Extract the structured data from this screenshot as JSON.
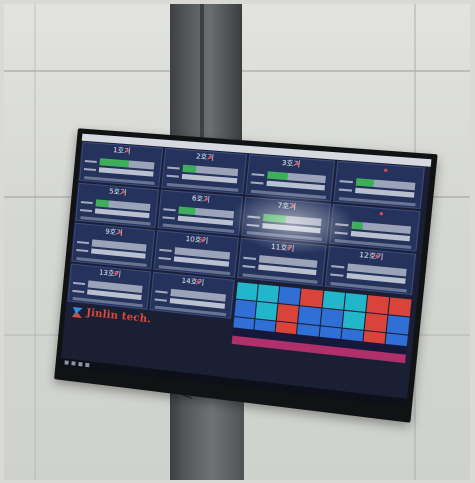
{
  "scene": {
    "description_free": true
  },
  "dashboard": {
    "tiles": [
      {
        "name": "1호기",
        "fill": 0.55
      },
      {
        "name": "2호기",
        "fill": 0.25
      },
      {
        "name": "3호기",
        "fill": 0.35
      },
      {
        "name": "",
        "fill": 0.3
      },
      {
        "name": "5호기",
        "fill": 0.25
      },
      {
        "name": "6호기",
        "fill": 0.3
      },
      {
        "name": "7호기",
        "fill": 0.4
      },
      {
        "name": "",
        "fill": 0.2
      },
      {
        "name": "9호기",
        "fill": 0.0
      },
      {
        "name": "10호기",
        "fill": 0.0
      },
      {
        "name": "11호기",
        "fill": 0.0
      },
      {
        "name": "12호기",
        "fill": 0.0
      },
      {
        "name": "13호기",
        "fill": 0.0
      },
      {
        "name": "14호기",
        "fill": 0.0
      }
    ],
    "logo_text": "Jinlin tech."
  },
  "colors": {
    "tile_bg": "#24325c",
    "progress_green": "#3fae5a",
    "kpi_cyan": "#21b6c9",
    "kpi_blue": "#2f6fd6",
    "kpi_red": "#d9433a",
    "kpi_magenta": "#b0306b",
    "logo_red": "#e04a3a"
  }
}
